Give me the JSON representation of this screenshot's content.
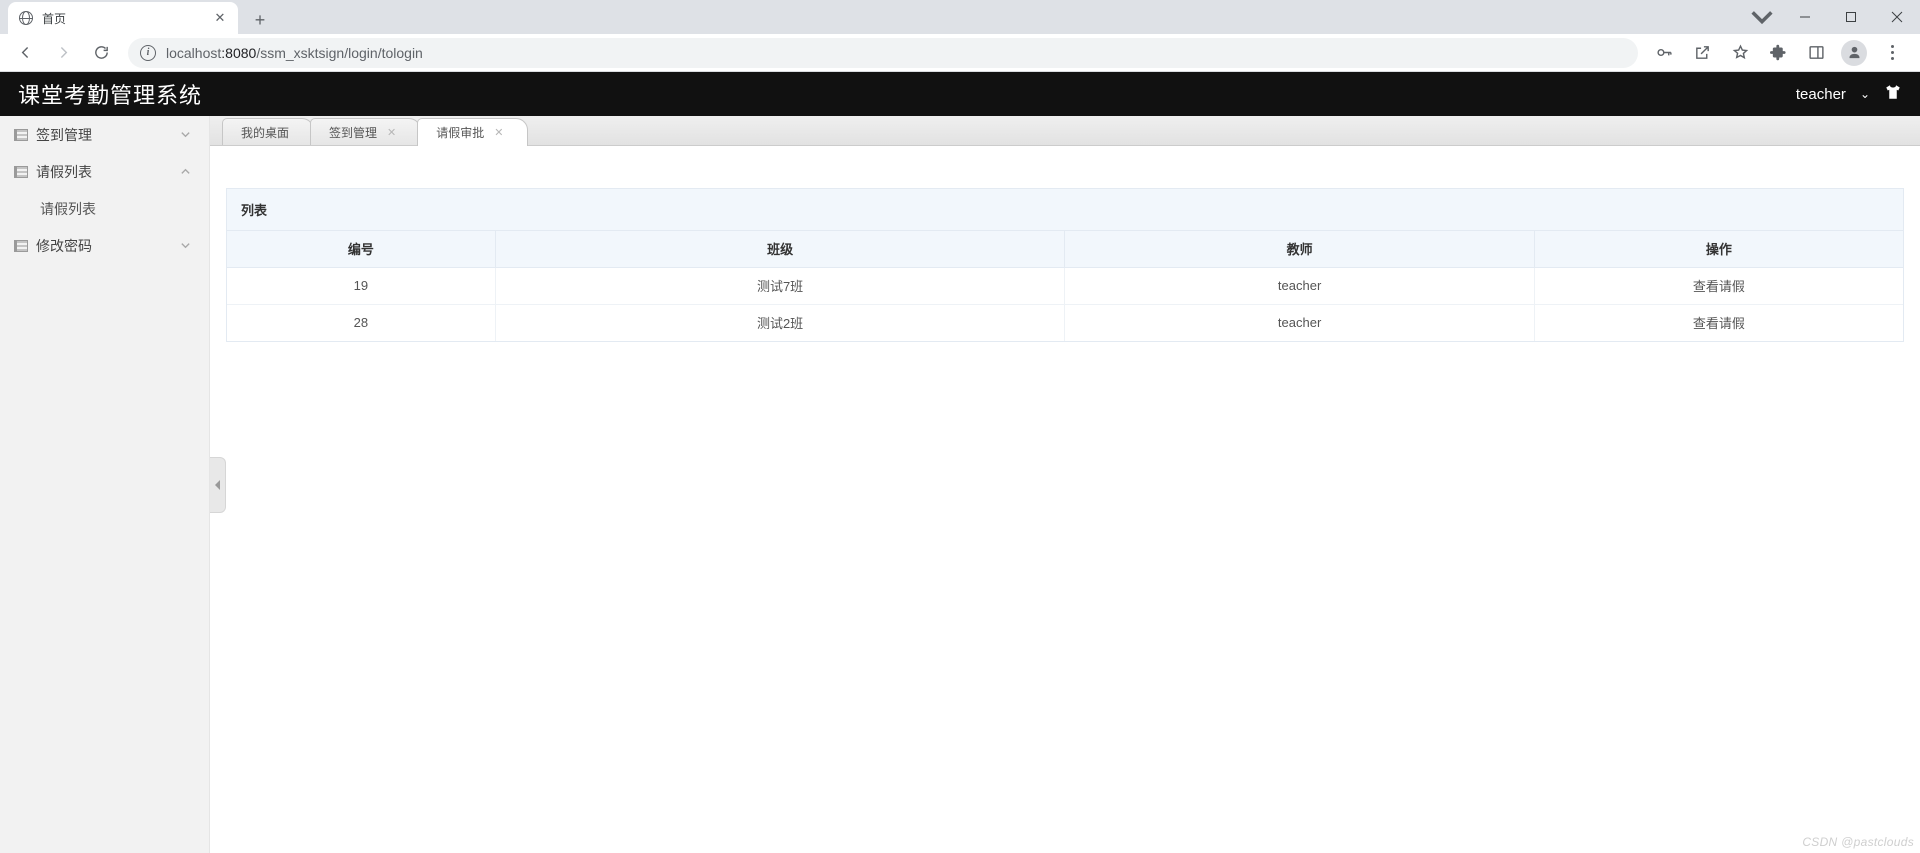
{
  "browser": {
    "tab_title": "首页",
    "url_host": "localhost",
    "url_port": ":8080",
    "url_path": "/ssm_xsktsign/login/tologin"
  },
  "app": {
    "title": "课堂考勤管理系统",
    "user": "teacher"
  },
  "sidebar": {
    "items": [
      {
        "label": "签到管理",
        "type": "parent",
        "expanded": false
      },
      {
        "label": "请假列表",
        "type": "parent",
        "expanded": true
      },
      {
        "label": "请假列表",
        "type": "child"
      },
      {
        "label": "修改密码",
        "type": "parent",
        "expanded": false
      }
    ]
  },
  "tabs": [
    {
      "label": "我的桌面",
      "closable": false,
      "active": false
    },
    {
      "label": "签到管理",
      "closable": true,
      "active": false
    },
    {
      "label": "请假审批",
      "closable": true,
      "active": true
    }
  ],
  "panel": {
    "title": "列表",
    "columns": [
      "编号",
      "班级",
      "教师",
      "操作"
    ],
    "rows": [
      {
        "id": "19",
        "class": "测试7班",
        "teacher": "teacher",
        "action": "查看请假"
      },
      {
        "id": "28",
        "class": "测试2班",
        "teacher": "teacher",
        "action": "查看请假"
      }
    ]
  },
  "watermark": "CSDN @pastclouds"
}
